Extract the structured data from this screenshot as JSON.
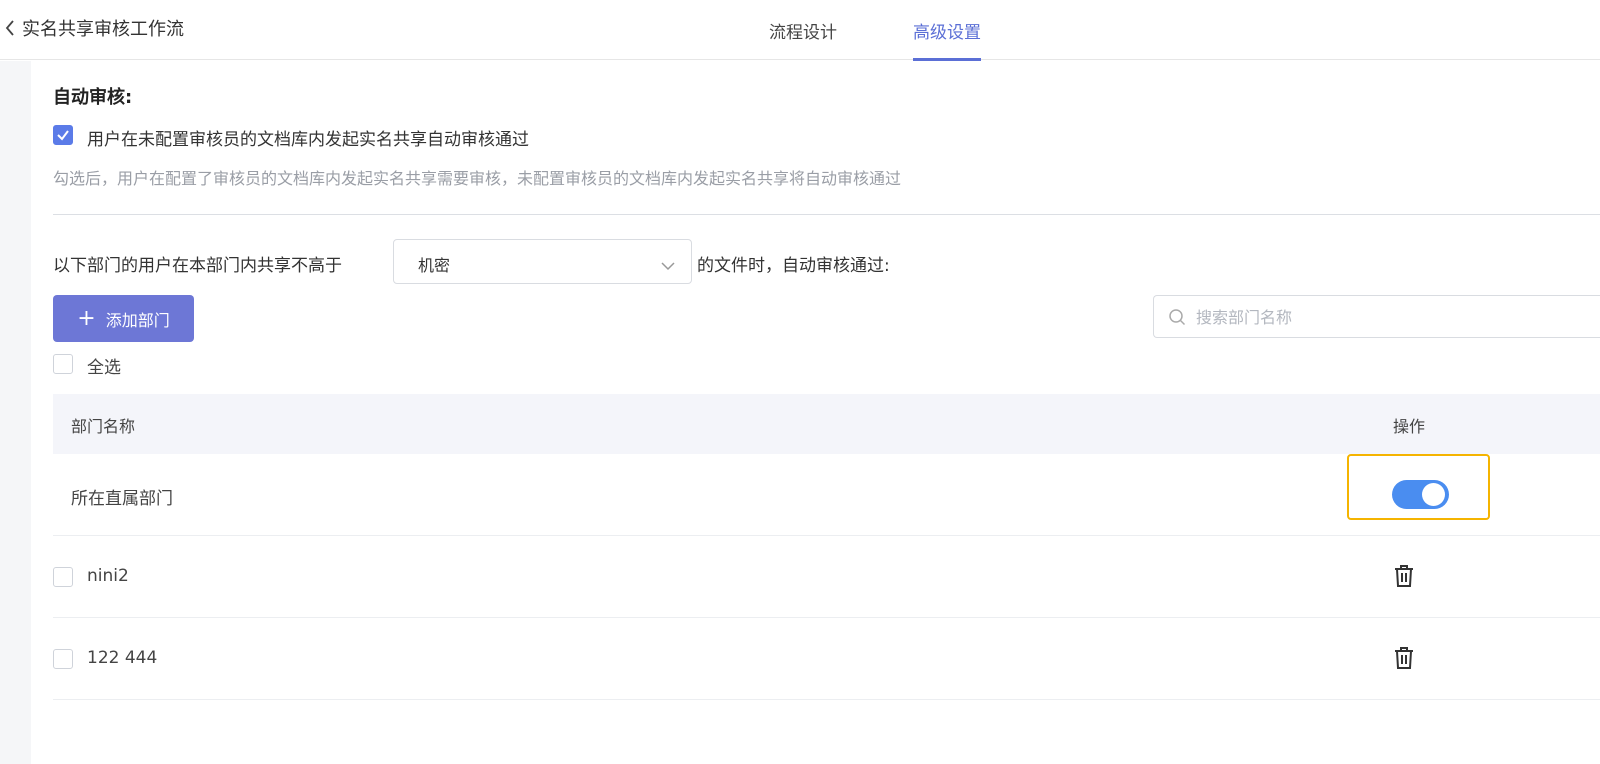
{
  "header": {
    "back_title": "实名共享审核工作流",
    "tabs": [
      {
        "label": "流程设计",
        "active": false
      },
      {
        "label": "高级设置",
        "active": true
      }
    ]
  },
  "auto_review": {
    "title": "自动审核:",
    "checkbox_label": "用户在未配置审核员的文档库内发起实名共享自动审核通过",
    "checkbox_checked": true,
    "hint": "勾选后，用户在配置了审核员的文档库内发起实名共享需要审核，未配置审核员的文档库内发起实名共享将自动审核通过"
  },
  "rule": {
    "prefix": "以下部门的用户在本部门内共享不高于",
    "security_level": "机密",
    "suffix": "的文件时，自动审核通过:"
  },
  "toolbar": {
    "add_label": "添加部门",
    "search_placeholder": "搜索部门名称",
    "select_all_label": "全选"
  },
  "table": {
    "columns": [
      "部门名称",
      "操作"
    ],
    "rows": [
      {
        "name": "所在直属部门",
        "action": "toggle",
        "toggle_on": true
      },
      {
        "name": "nini2",
        "action": "delete"
      },
      {
        "name": "122 444",
        "action": "delete"
      }
    ]
  },
  "colors": {
    "accent": "#5b6fd6",
    "button": "#6d77d6",
    "toggle_on": "#4a8df0",
    "highlight": "#f5b400"
  }
}
